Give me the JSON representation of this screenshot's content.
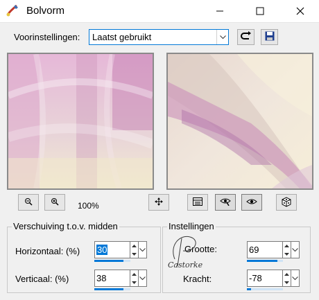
{
  "window": {
    "title": "Bolvorm"
  },
  "presets": {
    "label": "Voorinstellingen:",
    "selected": "Laatst gebruikt"
  },
  "preview": {
    "zoom": "100%"
  },
  "offset_group": {
    "title": "Verschuiving t.o.v. midden",
    "horizontal": {
      "label": "Horizontaal: (%)",
      "value": "30",
      "fraction": 0.8
    },
    "vertical": {
      "label": "Verticaal: (%)",
      "value": "38",
      "fraction": 0.8
    }
  },
  "settings_group": {
    "title": "Instellingen",
    "size": {
      "label": "Grootte:",
      "value": "69",
      "fraction": 0.85
    },
    "strength": {
      "label": "Kracht:",
      "value": "-78",
      "fraction": 0.12
    }
  },
  "watermark": {
    "text": "Castorke"
  },
  "colors": {
    "accent": "#0078d7",
    "pink": "#d8a8cc",
    "cream": "#efe6d2"
  }
}
